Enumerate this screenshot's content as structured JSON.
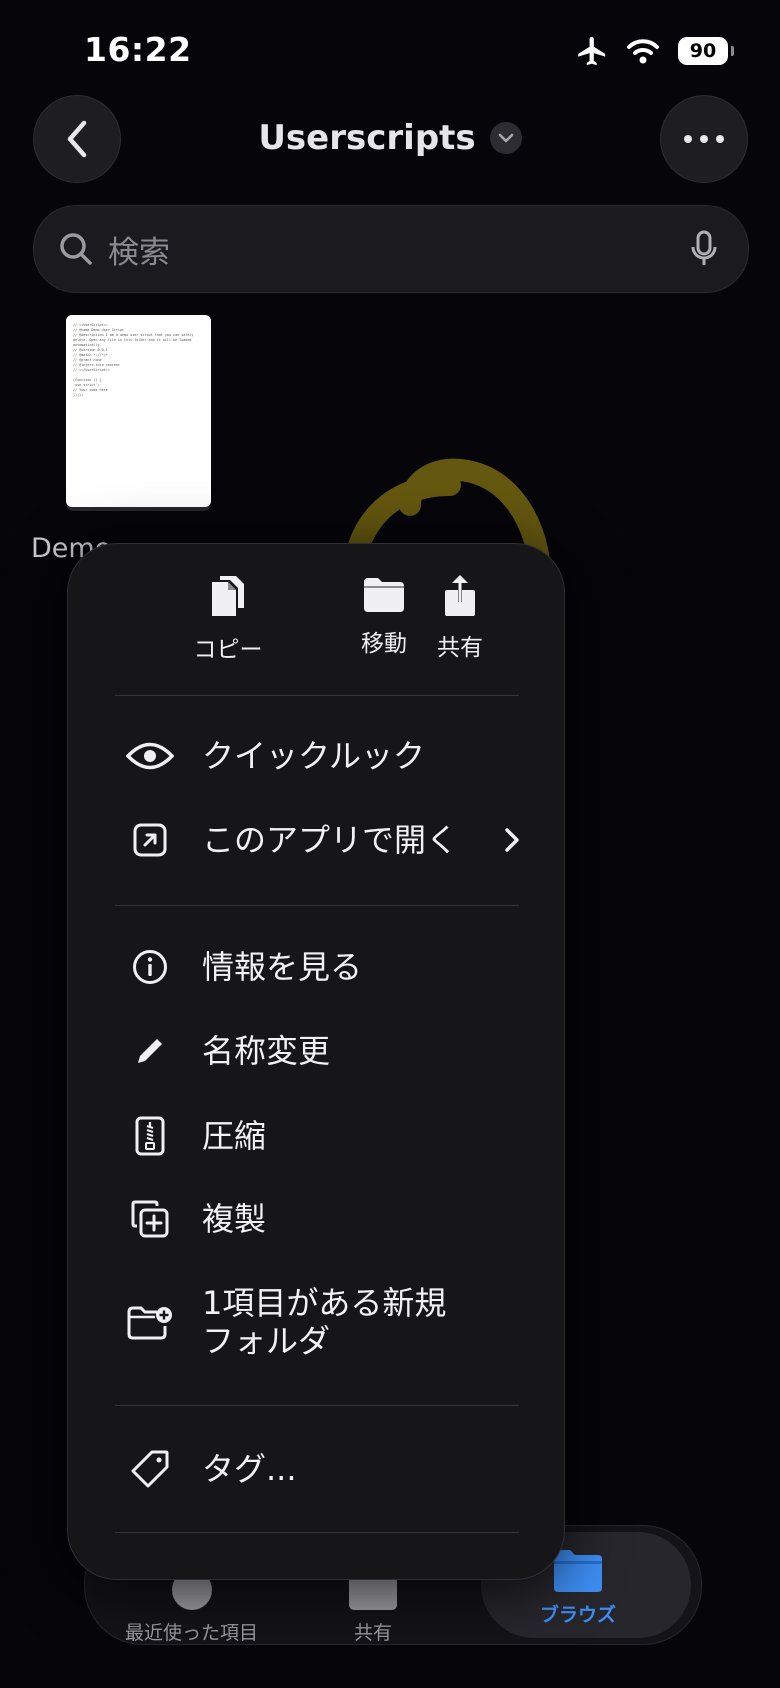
{
  "status": {
    "time": "16:22",
    "battery": "90"
  },
  "nav": {
    "title": "Userscripts"
  },
  "search": {
    "placeholder": "検索"
  },
  "file": {
    "name": "Demo",
    "preview_lines": [
      "// ==UserScript==",
      "// @name        Demo User Script",
      "// @description  I am a demo user script that you can safely",
      "delete. Open any file in this folder and it will be loaded",
      "automatically.",
      "// @version      0.0.1",
      "// @match        *://*/*",
      "// @grant        none",
      "// @inject-into  content",
      "// ==/UserScript==",
      "",
      "(function () {",
      "  'use strict';",
      "  // Your code here",
      "})();"
    ]
  },
  "menu": {
    "quick_actions": [
      {
        "label": "コピー",
        "icon": "copy-icon"
      },
      {
        "label": "移動",
        "icon": "folder-icon"
      },
      {
        "label": "共有",
        "icon": "share-icon"
      }
    ],
    "quick_look": "クイックルック",
    "open_in_app": "このアプリで開く",
    "get_info": "情報を見る",
    "rename": "名称変更",
    "compress": "圧縮",
    "duplicate": "複製",
    "new_folder_line1": "1項目がある新規",
    "new_folder_line2": "フォルダ",
    "tags": "タグ..."
  },
  "tabbar": {
    "recents": "最近使った項目",
    "shared": "共有",
    "browse": "ブラウズ",
    "active_color": "#3d8ff5"
  },
  "annotation_color": "#b39a14"
}
